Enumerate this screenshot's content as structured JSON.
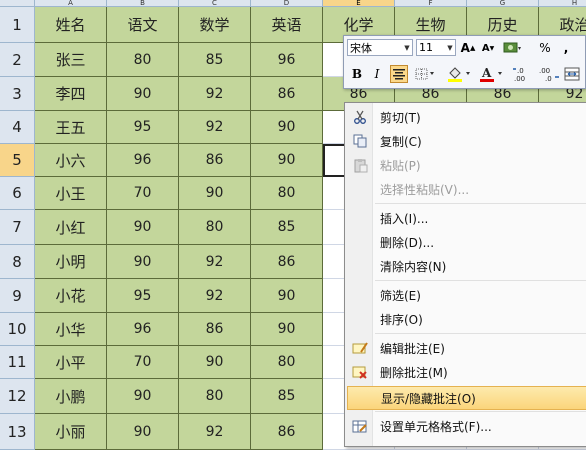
{
  "columns": [
    "A",
    "B",
    "C",
    "D",
    "E",
    "F",
    "G",
    "H"
  ],
  "rows": [
    "1",
    "2",
    "3",
    "4",
    "5",
    "6",
    "7",
    "8",
    "9",
    "10",
    "11",
    "12",
    "13"
  ],
  "headers": [
    "姓名",
    "语文",
    "数学",
    "英语",
    "化学",
    "生物",
    "历史",
    "政治"
  ],
  "data": [
    [
      "张三",
      "80",
      "85",
      "96"
    ],
    [
      "李四",
      "90",
      "92",
      "86",
      "86",
      "86",
      "86",
      "92"
    ],
    [
      "王五",
      "95",
      "92",
      "90"
    ],
    [
      "小六",
      "96",
      "86",
      "90"
    ],
    [
      "小王",
      "70",
      "90",
      "80"
    ],
    [
      "小红",
      "90",
      "80",
      "85"
    ],
    [
      "小明",
      "90",
      "92",
      "86"
    ],
    [
      "小花",
      "95",
      "92",
      "90"
    ],
    [
      "小华",
      "96",
      "86",
      "90"
    ],
    [
      "小平",
      "70",
      "90",
      "80"
    ],
    [
      "小鹏",
      "90",
      "80",
      "85"
    ],
    [
      "小丽",
      "90",
      "92",
      "86"
    ]
  ],
  "mini_toolbar": {
    "font_name": "宋体",
    "font_size": "11",
    "grow_font": "A",
    "shrink_font": "A",
    "percent": "%",
    "comma": ",",
    "bold": "B",
    "italic": "I",
    "increase_decimal": ".0→.00",
    "decrease_decimal": ".00→.0"
  },
  "context_menu": [
    {
      "label": "剪切(T)",
      "icon": "scissors-icon",
      "disabled": false
    },
    {
      "label": "复制(C)",
      "icon": "copy-icon",
      "disabled": false
    },
    {
      "label": "粘贴(P)",
      "icon": "paste-icon",
      "disabled": true
    },
    {
      "label": "选择性粘贴(V)...",
      "icon": "",
      "disabled": true
    },
    {
      "label": "插入(I)...",
      "icon": "",
      "disabled": false
    },
    {
      "label": "删除(D)...",
      "icon": "",
      "disabled": false
    },
    {
      "label": "清除内容(N)",
      "icon": "",
      "disabled": false
    },
    {
      "label": "筛选(E)",
      "icon": "",
      "disabled": false
    },
    {
      "label": "排序(O)",
      "icon": "",
      "disabled": false
    },
    {
      "label": "编辑批注(E)",
      "icon": "edit-comment-icon",
      "disabled": false
    },
    {
      "label": "删除批注(M)",
      "icon": "delete-comment-icon",
      "disabled": false
    },
    {
      "label": "显示/隐藏批注(O)",
      "icon": "",
      "disabled": false,
      "highlighted": true
    },
    {
      "label": "设置单元格格式(F)...",
      "icon": "format-cells-icon",
      "disabled": false
    }
  ],
  "colors": {
    "cell_fill": "#c3d69b",
    "header_selected": "#f8d58a",
    "menu_highlight": "#fbd57b"
  }
}
